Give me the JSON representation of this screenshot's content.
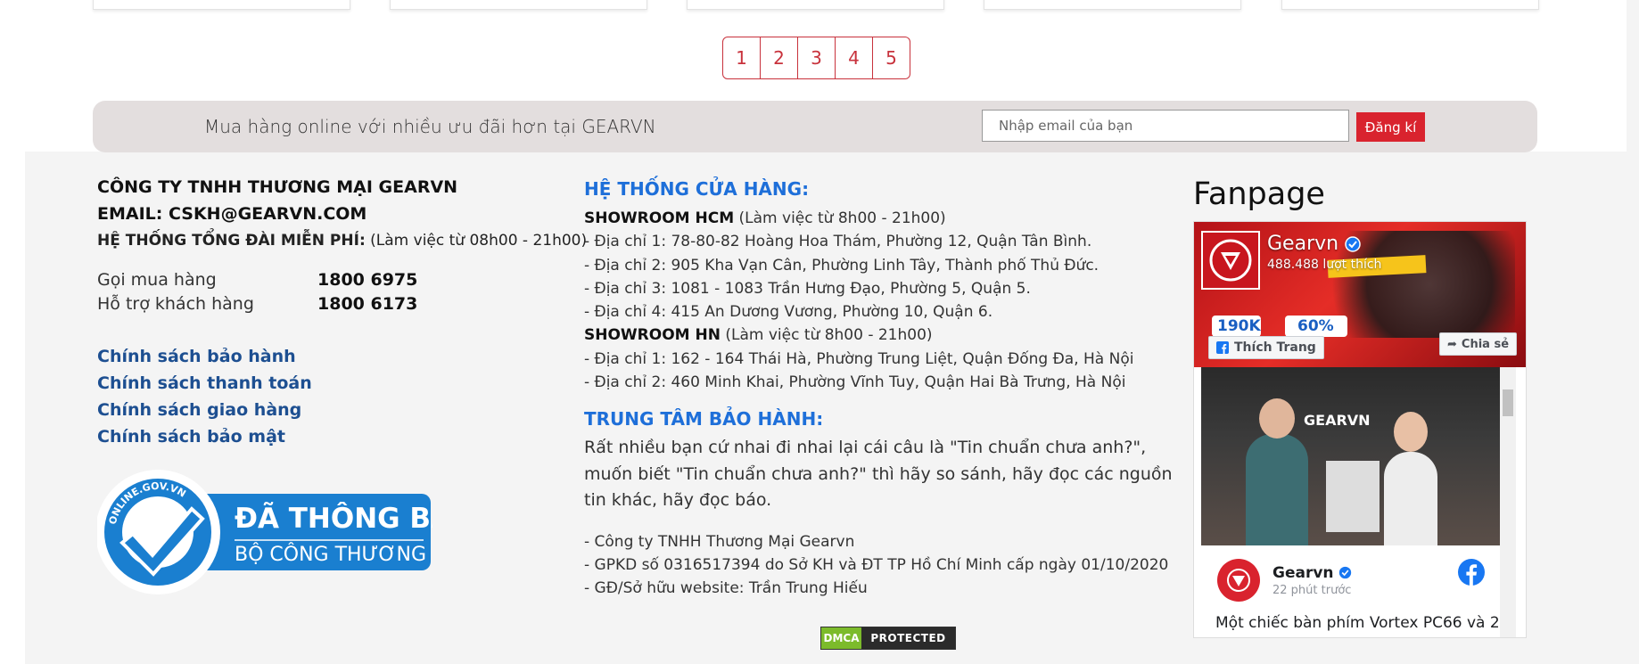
{
  "pagination": {
    "pages": [
      "1",
      "2",
      "3",
      "4",
      "5"
    ]
  },
  "newsletter": {
    "text": "Mua hàng online với nhiều ưu đãi hơn tại GEARVN",
    "email_placeholder": "Nhập email của bạn",
    "submit_label": "Đăng kí"
  },
  "company": {
    "name": "CÔNG TY TNHH THƯƠNG MẠI GEARVN",
    "email": "EMAIL: CSKH@GEARVN.COM",
    "hotline_label": "HỆ THỐNG TỔNG ĐÀI MIỄN PHÍ:",
    "hotline_hours": "(Làm việc từ 08h00 - 21h00)",
    "phones": [
      {
        "label": "Gọi mua hàng",
        "value": "1800 6975"
      },
      {
        "label": "Hỗ trợ khách hàng",
        "value": "1800 6173"
      }
    ],
    "policies": [
      "Chính sách bảo hành",
      "Chính sách thanh toán",
      "Chính sách giao hàng",
      "Chính sách bảo mật"
    ],
    "gov_badge": {
      "ring_text": "ONLINE.GOV.VN",
      "line1": "ĐÃ THÔNG BÁO",
      "line2": "BỘ CÔNG THƯƠNG"
    }
  },
  "stores": {
    "title": "HỆ THỐNG CỬA HÀNG:",
    "hcm_title": "SHOWROOM HCM",
    "hcm_hours": "(Làm việc từ 8h00 - 21h00)",
    "hcm_addresses": [
      "- Địa chỉ 1: 78-80-82 Hoàng Hoa Thám, Phường 12, Quận Tân Bình.",
      "- Địa chỉ 2: 905 Kha Vạn Cân, Phường Linh Tây, Thành phố Thủ Đức.",
      "- Địa chỉ 3: 1081 - 1083 Trần Hưng Đạo, Phường 5, Quận 5.",
      "- Địa chỉ 4: 415 An Dương Vương, Phường 10, Quận 6."
    ],
    "hn_title": "SHOWROOM HN",
    "hn_hours": "(Làm việc từ 8h00 - 21h00)",
    "hn_addresses": [
      "- Địa chỉ 1: 162 - 164 Thái Hà, Phường Trung Liệt, Quận Đống Đa, Hà Nội",
      "- Địa chỉ 2: 460 Minh Khai, Phường Vĩnh Tuy, Quận Hai Bà Trưng, Hà Nội"
    ]
  },
  "warranty": {
    "title": "TRUNG TÂM BẢO HÀNH:",
    "text": "Rất nhiều bạn cứ nhai đi nhai lại cái câu là \"Tin chuẩn chưa anh?\", muốn biết \"Tin chuẩn chưa anh?\" thì hãy so sánh, hãy đọc các nguồn tin khác, hãy đọc báo."
  },
  "legal": [
    "- Công ty TNHH Thương Mại Gearvn",
    "- GPKD số 0316517394 do Sở KH và ĐT TP Hồ Chí Minh cấp ngày 01/10/2020",
    "- GĐ/Sở hữu website: Trần Trung Hiếu"
  ],
  "dmca": {
    "left": "DMCA",
    "right": "PROTECTED"
  },
  "fanpage": {
    "title": "Fanpage",
    "page_name": "Gearvn",
    "likes": "488.488 lượt thích",
    "like_label": "Thích Trang",
    "share_label": "Chia sẻ",
    "cover_price1": "190K",
    "cover_price2": "60%",
    "post_author": "Gearvn",
    "post_time": "22 phút trước",
    "post_text": "Một chiếc bàn phím Vortex PC66 và 2",
    "post_sign_text": "GEARVN"
  },
  "colors": {
    "brand_red": "#d9232e",
    "link_blue": "#1d4f91",
    "title_blue": "#1e6fd9",
    "facebook_blue": "#1877f2"
  }
}
